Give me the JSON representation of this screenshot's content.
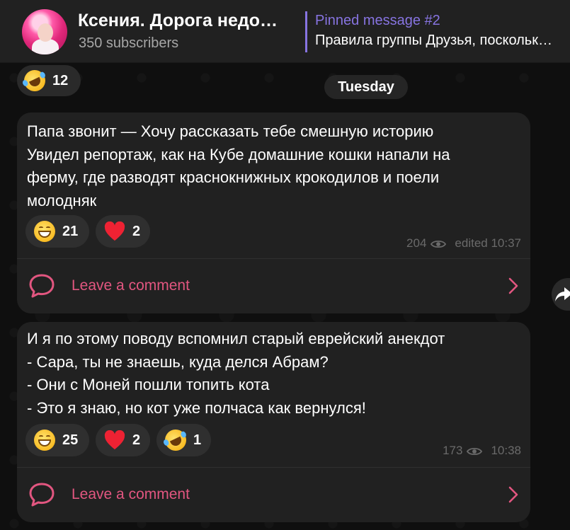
{
  "header": {
    "channel_title": "Ксения. Дорога недо…",
    "subscribers": "350 subscribers",
    "pinned_title": "Pinned message #2",
    "pinned_text": "Правила группы Друзья, поскольк…"
  },
  "prev_message": {
    "reaction_emoji": "rolling-on-floor-laughing",
    "reaction_count": "12"
  },
  "date_separator": "Tuesday",
  "messages": [
    {
      "lines": [
        "Папа звонит — Хочу рассказать тебе смешную историю",
        "Увидел репортаж, как на Кубе домашние кошки напали на",
        "ферму, где разводят краснокнижных крокодилов и поели",
        "молодняк"
      ],
      "reactions": [
        {
          "emoji": "grinning-face",
          "count": "21"
        },
        {
          "emoji": "red-heart",
          "count": "2"
        }
      ],
      "views": "204",
      "time": "edited 10:37",
      "comment_label": "Leave a comment"
    },
    {
      "lines": [
        "И я по этому поводу вспомнил старый еврейский анекдот",
        "- Сара, ты не знаешь, куда делся Абрам?",
        "- Они с Моней пошли топить кота",
        "- Это я знаю, но кот уже полчаса как вернулся!"
      ],
      "reactions": [
        {
          "emoji": "grinning-face",
          "count": "25"
        },
        {
          "emoji": "red-heart",
          "count": "2"
        },
        {
          "emoji": "rolling-on-floor-laughing",
          "count": "1"
        }
      ],
      "views": "173",
      "time": "10:38",
      "comment_label": "Leave a comment"
    }
  ],
  "colors": {
    "accent": "#8774e1",
    "comment": "#e25680",
    "bubble": "#212121",
    "header": "#212121"
  }
}
